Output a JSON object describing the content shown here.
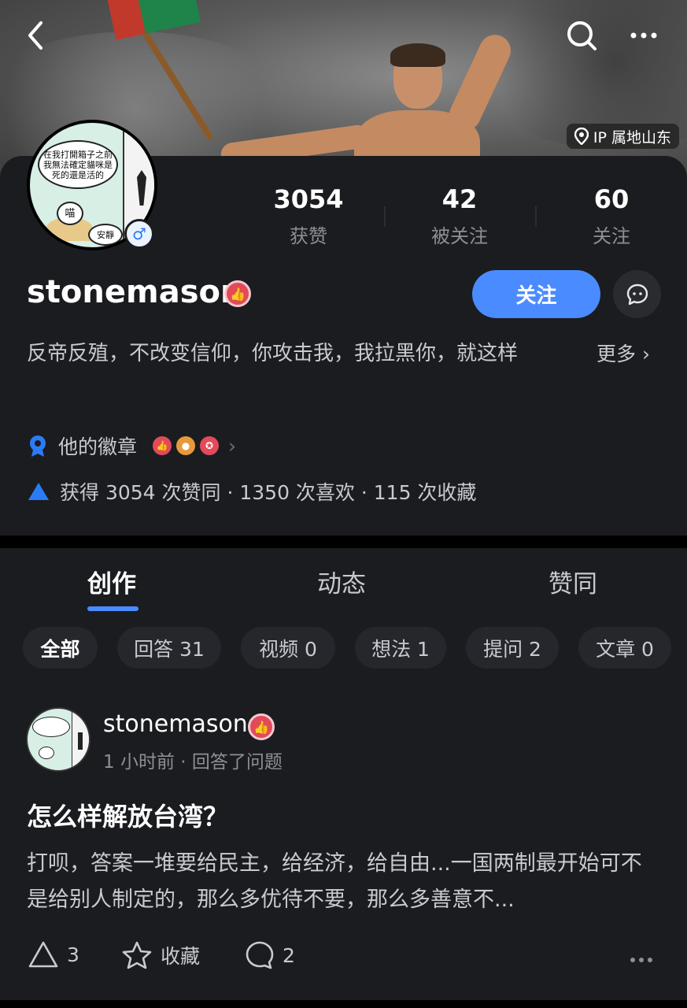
{
  "header": {
    "ip_location": "IP 属地山东"
  },
  "avatar": {
    "bubble_text_1": "在我打開箱子之前我無法確定貓咪是死的還是活的",
    "bubble_text_2": "喵",
    "bubble_text_3": "安靜",
    "gender_symbol": "♂"
  },
  "stats": [
    {
      "num": "3054",
      "label": "获赞"
    },
    {
      "num": "42",
      "label": "被关注"
    },
    {
      "num": "60",
      "label": "关注"
    }
  ],
  "profile": {
    "username": "stonemason",
    "follow_label": "关注",
    "bio": "反帝反殖，不改变信仰，你攻击我，我拉黑你，就这样",
    "more_label": "更多 ›",
    "badges_label": "他的徽章",
    "badges_chevron": "›",
    "engagement": "获得 3054 次赞同 · 1350 次喜欢 · 115 次收藏"
  },
  "tabs": [
    {
      "label": "创作"
    },
    {
      "label": "动态"
    },
    {
      "label": "赞同"
    }
  ],
  "chips": [
    {
      "label": "全部"
    },
    {
      "label": "回答 31"
    },
    {
      "label": "视频 0"
    },
    {
      "label": "想法 1"
    },
    {
      "label": "提问 2"
    },
    {
      "label": "文章 0"
    }
  ],
  "post": {
    "author": "stonemason",
    "meta": "1 小时前 · 回答了问题",
    "title": "怎么样解放台湾？",
    "excerpt": "打呗，答案一堆要给民主，给经济，给自由...一国两制最开始可不是给别人制定的，那么多优待不要，那么多善意不...",
    "upvotes": "3",
    "collect_label": "收藏",
    "comments": "2"
  },
  "colors": {
    "background": "#1b1c20",
    "accent": "#4a8cff",
    "badge_red": "#e24a5a"
  }
}
